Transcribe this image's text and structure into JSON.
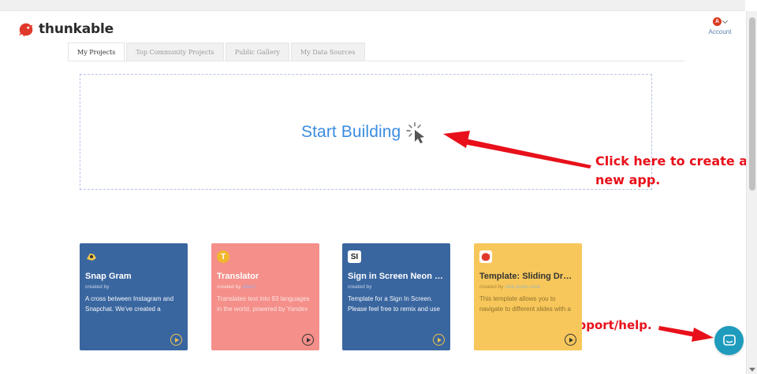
{
  "app": {
    "logo_text": "thunkable"
  },
  "account": {
    "initial": "A",
    "label": "Account"
  },
  "tabs": [
    {
      "label": "My Projects",
      "active": true
    },
    {
      "label": "Top Community Projects",
      "active": false
    },
    {
      "label": "Public Gallery",
      "active": false
    },
    {
      "label": "My Data Sources",
      "active": false
    }
  ],
  "start": {
    "label": "Start Building"
  },
  "callouts": {
    "create_app": "Click here to create a new app.",
    "support": "Live support/help."
  },
  "projects": [
    {
      "title": "Snap Gram",
      "created_by": "created by",
      "author": "",
      "description": "A cross between Instagram and Snapchat. We've created a",
      "icon": "snapchat-icon",
      "color": "#3a66a0"
    },
    {
      "title": "Translator",
      "created_by": "created by",
      "author": "albert",
      "description": "Translates text into 93 languages in the world, powered by Yandex",
      "icon_text": "T",
      "color": "#f48f8a"
    },
    {
      "title": "Sign in Screen Neon Su...",
      "created_by": "created by",
      "author": "",
      "description": "Template for a Sign In Screen. Please feel free to remix and use",
      "icon_text": "SI",
      "color": "#3a66a0"
    },
    {
      "title": "Template: Sliding Drawer",
      "created_by": "created by",
      "author": "nice-jimbo-slice",
      "description": "This template allows you to navigate to different slides with a",
      "icon": "thunkable-icon",
      "color": "#f7c75b"
    }
  ],
  "colors": {
    "accent": "#3a8ce0",
    "callout": "#e8101a",
    "support": "#1f9bbd"
  }
}
